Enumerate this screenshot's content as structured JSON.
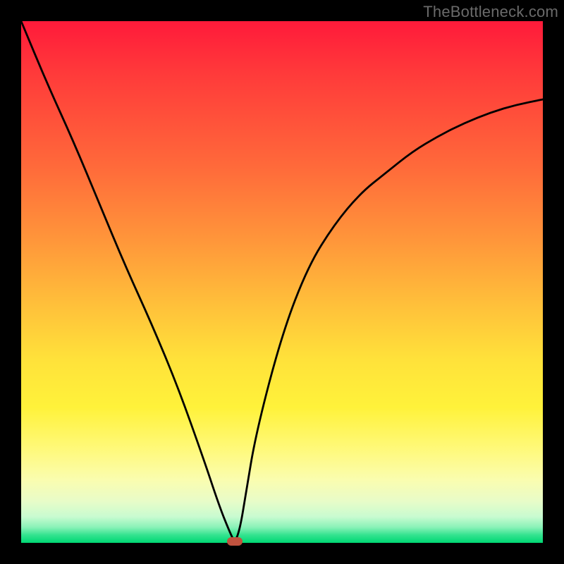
{
  "watermark": "TheBottleneck.com",
  "colors": {
    "frame": "#000000",
    "curve_stroke": "#000000",
    "marker": "#c0523e",
    "gradient_top": "#ff1a3a",
    "gradient_bottom": "#00d873"
  },
  "chart_data": {
    "type": "line",
    "title": "",
    "xlabel": "",
    "ylabel": "",
    "xlim": [
      0,
      100
    ],
    "ylim": [
      0,
      100
    ],
    "grid": false,
    "legend": false,
    "series": [
      {
        "name": "bottleneck-curve",
        "x": [
          0,
          5,
          10,
          15,
          20,
          25,
          30,
          35,
          38,
          40,
          41,
          42,
          43,
          45,
          50,
          55,
          60,
          65,
          70,
          75,
          80,
          85,
          90,
          95,
          100
        ],
        "values": [
          100,
          88,
          77,
          65,
          53,
          42,
          30,
          16,
          7,
          2,
          0,
          3,
          9,
          21,
          40,
          53,
          61,
          67,
          71,
          75,
          78,
          80.5,
          82.5,
          84,
          85
        ]
      }
    ],
    "minimum_marker": {
      "x": 41,
      "y": 0
    }
  }
}
